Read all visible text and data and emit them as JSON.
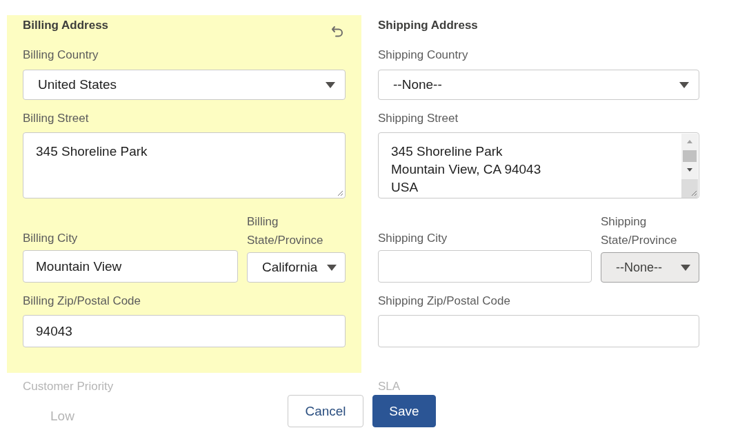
{
  "sections": [
    {
      "title": "Billing Address",
      "highlighted": true,
      "country": {
        "label": "Billing Country",
        "value": "United States"
      },
      "street": {
        "label": "Billing Street",
        "value": "345 Shoreline Park"
      },
      "city": {
        "label": "Billing City",
        "value": "Mountain View"
      },
      "state": {
        "label": "Billing State/Province",
        "value": "California",
        "disabled": false
      },
      "zip": {
        "label": "Billing Zip/Postal Code",
        "value": "94043"
      }
    },
    {
      "title": "Shipping Address",
      "highlighted": false,
      "country": {
        "label": "Shipping Country",
        "value": "--None--"
      },
      "street": {
        "label": "Shipping Street",
        "value": "345 Shoreline Park\nMountain View, CA 94043\nUSA"
      },
      "city": {
        "label": "Shipping City"
      },
      "state": {
        "label": "Shipping State/Province",
        "value": "--None--",
        "disabled": true
      },
      "zip": {
        "label": "Shipping Zip/Postal Code"
      }
    }
  ],
  "faded_fields": [
    {
      "label": "Customer Priority",
      "value": "Low"
    },
    {
      "label": "SLA"
    }
  ],
  "buttons": [
    {
      "label": "Cancel",
      "kind": "neutral"
    },
    {
      "label": "Save",
      "kind": "brand"
    }
  ]
}
